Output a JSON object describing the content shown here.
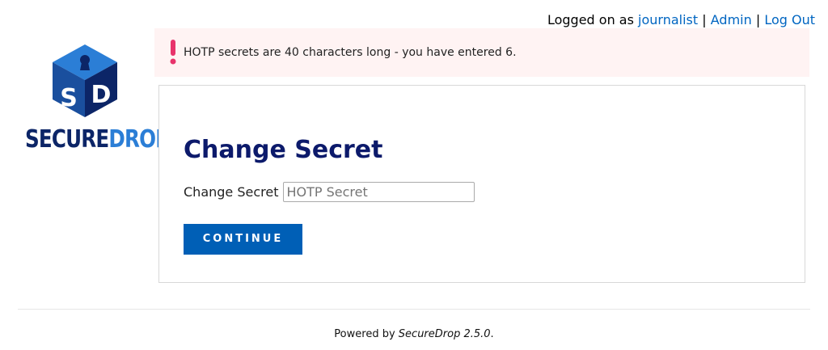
{
  "topnav": {
    "prefix": "Logged on as",
    "username": "journalist",
    "separator": "|",
    "admin_label": "Admin",
    "logout_label": "Log Out"
  },
  "logo": {
    "word_secure": "SECURE",
    "word_drop": "DROP",
    "cube_letters": [
      "S",
      "D"
    ],
    "colors": {
      "top": "#2b7ed6",
      "left": "#1a4f9e",
      "right": "#0c2567"
    }
  },
  "flash": {
    "message": "HOTP secrets are 40 characters long - you have entered 6.",
    "icon": "exclamation-icon",
    "icon_color": "#e8336b"
  },
  "form": {
    "title": "Change Secret",
    "field_label": "Change Secret",
    "field_placeholder": "HOTP Secret",
    "field_value": "",
    "submit_label": "CONTINUE"
  },
  "footer": {
    "prefix": "Powered by",
    "product": "SecureDrop 2.5.0",
    "suffix": "."
  },
  "colors": {
    "link": "#0065c1",
    "heading": "#0c1a6b",
    "button": "#005fb6",
    "flash_bg": "#fff3f3"
  }
}
